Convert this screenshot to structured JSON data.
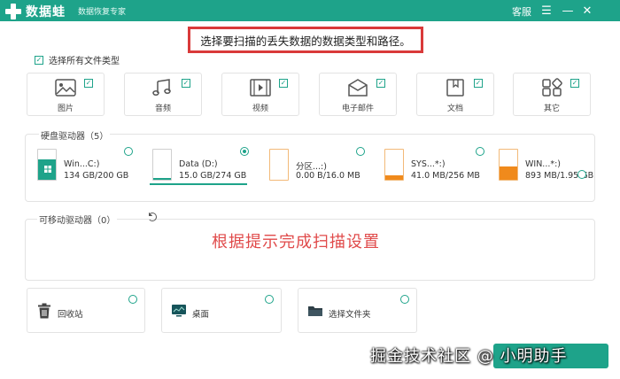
{
  "app": {
    "name": "数据蛙",
    "subtitle": "数据恢复专家"
  },
  "titlebar": {
    "service": "客服",
    "menu": "☰",
    "minimize": "—",
    "close": "✕"
  },
  "hint": "选择要扫描的丢失数据的数据类型和路径。",
  "select_all": {
    "label": "选择所有文件类型",
    "checked": true
  },
  "file_types": [
    {
      "label": "图片",
      "icon": "image-icon",
      "checked": true
    },
    {
      "label": "音频",
      "icon": "music-icon",
      "checked": true
    },
    {
      "label": "视频",
      "icon": "video-icon",
      "checked": true
    },
    {
      "label": "电子邮件",
      "icon": "email-icon",
      "checked": true
    },
    {
      "label": "文档",
      "icon": "document-icon",
      "checked": true
    },
    {
      "label": "其它",
      "icon": "other-icon",
      "checked": true
    }
  ],
  "hard_drives": {
    "title": "硬盘驱动器（5）",
    "items": [
      {
        "name": "Win...C:)",
        "size": "134 GB/200 GB",
        "fill": 0.67,
        "color": "#1ea38a",
        "selected": false,
        "icon": "windows-icon"
      },
      {
        "name": "Data (D:)",
        "size": "15.0 GB/274 GB",
        "fill": 0.05,
        "color": "#1ea38a",
        "selected": true,
        "icon": "drive-icon"
      },
      {
        "name": "分区...:)",
        "size": "0.00  B/16.0 MB",
        "fill": 0.0,
        "color": "#1ea38a",
        "selected": false,
        "icon": "drive-icon"
      },
      {
        "name": "SYS...*:)",
        "size": "41.0 MB/256 MB",
        "fill": 0.16,
        "color": "#f08a1c",
        "selected": false,
        "icon": "drive-icon"
      },
      {
        "name": "WIN...*:)",
        "size": "893 MB/1.95 GB",
        "fill": 0.45,
        "color": "#f08a1c",
        "selected": false,
        "icon": "drive-icon"
      }
    ]
  },
  "removable": {
    "title": "可移动驱动器（0）"
  },
  "overlay_hint": "根据提示完成扫描设置",
  "locations": [
    {
      "label": "回收站",
      "icon": "recycle-bin-icon"
    },
    {
      "label": "桌面",
      "icon": "desktop-icon"
    },
    {
      "label": "选择文件夹",
      "icon": "folder-icon"
    }
  ],
  "watermark": "掘金技术社区 @ 小明助手",
  "colors": {
    "accent": "#1ea38a",
    "hint_border": "#d93a3a",
    "hint_red": "#e04a4a",
    "warn_orange": "#f08a1c"
  }
}
